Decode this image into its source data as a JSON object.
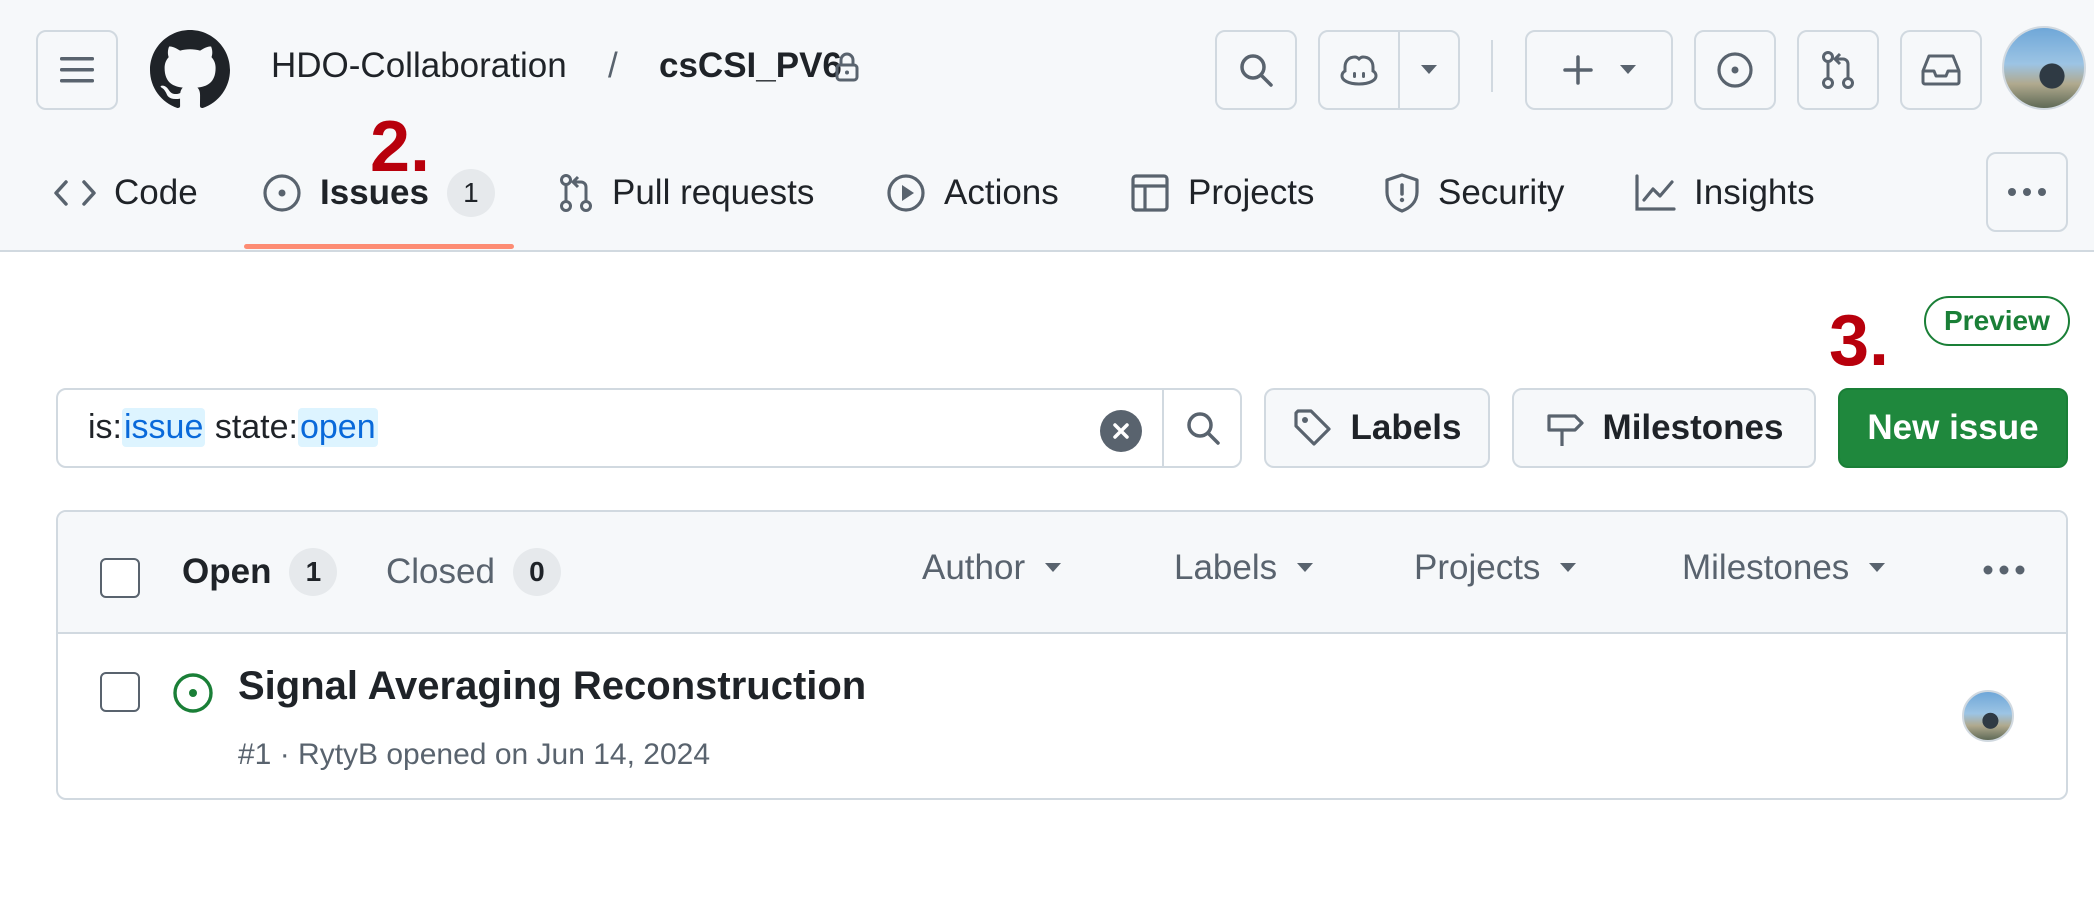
{
  "header": {
    "repo_owner": "HDO-Collaboration",
    "separator": "/",
    "repo_name": "csCSI_PV6",
    "icons": [
      "hamburger-icon",
      "github-mark-icon",
      "lock-icon",
      "search-icon",
      "copilot-icon",
      "chevron-down-icon",
      "plus-icon",
      "issue-opened-icon",
      "pull-request-icon",
      "inbox-icon",
      "avatar"
    ]
  },
  "tabs": [
    {
      "label": "Code",
      "icon": "code-icon"
    },
    {
      "label": "Issues",
      "icon": "issue-opened-icon",
      "count": "1",
      "selected": true
    },
    {
      "label": "Pull requests",
      "icon": "pull-request-icon"
    },
    {
      "label": "Actions",
      "icon": "play-icon"
    },
    {
      "label": "Projects",
      "icon": "table-icon"
    },
    {
      "label": "Security",
      "icon": "shield-icon"
    },
    {
      "label": "Insights",
      "icon": "graph-icon"
    }
  ],
  "annotations": {
    "step2": "2.",
    "step3": "3."
  },
  "toolbar": {
    "preview_badge": "Preview",
    "search": {
      "prefix1": "is:",
      "token1": "issue",
      "prefix2": " state:",
      "token2": "open"
    },
    "labels_button": "Labels",
    "milestones_button": "Milestones",
    "new_issue_button": "New issue"
  },
  "list": {
    "open_label": "Open",
    "open_count": "1",
    "closed_label": "Closed",
    "closed_count": "0",
    "filters": [
      "Author",
      "Labels",
      "Projects",
      "Milestones"
    ],
    "issues": [
      {
        "title": "Signal Averaging Reconstruction",
        "meta": "#1 · RytyB opened on Jun 14, 2024",
        "state": "open"
      }
    ]
  },
  "colors": {
    "accent_underline": "#fd8c73",
    "open_green": "#1a7f37",
    "primary_button": "#1f883d",
    "annotation_red": "#b8000c",
    "link_blue": "#0969da"
  }
}
